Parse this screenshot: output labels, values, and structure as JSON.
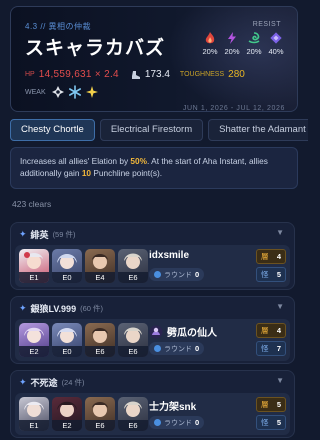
{
  "boss": {
    "subtitle": "4.3 // 異相の仲裁",
    "name": "スキャラカバズ",
    "hp_label": "HP",
    "hp_value": "14,559,631 × 2.4",
    "speed_icon": "boot-icon",
    "speed_value": "173.4",
    "toughness_label": "TOUGHNESS",
    "toughness_value": "280",
    "weak_label": "WEAK",
    "weaknesses": [
      "physical-icon",
      "ice-icon",
      "imaginary-icon"
    ],
    "resist_title": "RESIST",
    "resists": [
      {
        "icon": "fire-icon",
        "value": "20%",
        "color": "#e0463c"
      },
      {
        "icon": "lightning-icon",
        "value": "20%",
        "color": "#b455e0"
      },
      {
        "icon": "wind-icon",
        "value": "20%",
        "color": "#42c98c"
      },
      {
        "icon": "quantum-icon",
        "value": "40%",
        "color": "#7b62e6"
      }
    ],
    "date_range": "JUN 1, 2026 - JUL 12, 2026"
  },
  "tabs": [
    {
      "label": "Chesty Chortle",
      "active": true
    },
    {
      "label": "Electrical Firestorm",
      "active": false
    },
    {
      "label": "Shatter the Adamant",
      "active": false
    }
  ],
  "description": {
    "part1": "Increases all allies' Elation by ",
    "value1": "50%",
    "part2": ". At the start of Aha Instant, allies additionally gain ",
    "value2": "10",
    "part3": " Punchline point(s)."
  },
  "clears": "423 clears",
  "round_label": "ラウンド",
  "badge_labels": {
    "top": "層",
    "bottom": "怪"
  },
  "groups": [
    {
      "name": "緋英",
      "count": "(59 件)",
      "entry": {
        "avatars": [
          "E1",
          "E0",
          "E4",
          "E6"
        ],
        "player": "idxsmile",
        "player_icon": "",
        "round": "0",
        "badge_top": "4",
        "badge_bottom": "5"
      }
    },
    {
      "name": "銀狼LV.999",
      "count": "(60 件)",
      "entry": {
        "avatars": [
          "E2",
          "E0",
          "E6",
          "E6"
        ],
        "player": "劈瓜の仙人",
        "player_icon": "character-icon",
        "round": "0",
        "badge_top": "4",
        "badge_bottom": "7"
      }
    },
    {
      "name": "不死途",
      "count": "(24 件)",
      "entry": {
        "avatars": [
          "E1",
          "E2",
          "E6",
          "E6"
        ],
        "player": "士力架snk",
        "player_icon": "",
        "round": "0",
        "badge_top": "5",
        "badge_bottom": "5"
      }
    }
  ],
  "colors": {
    "accent": "#3e6ea8",
    "highlight": "#f0b63a",
    "hp": "#e34d4d",
    "toughness": "#e7b524"
  }
}
